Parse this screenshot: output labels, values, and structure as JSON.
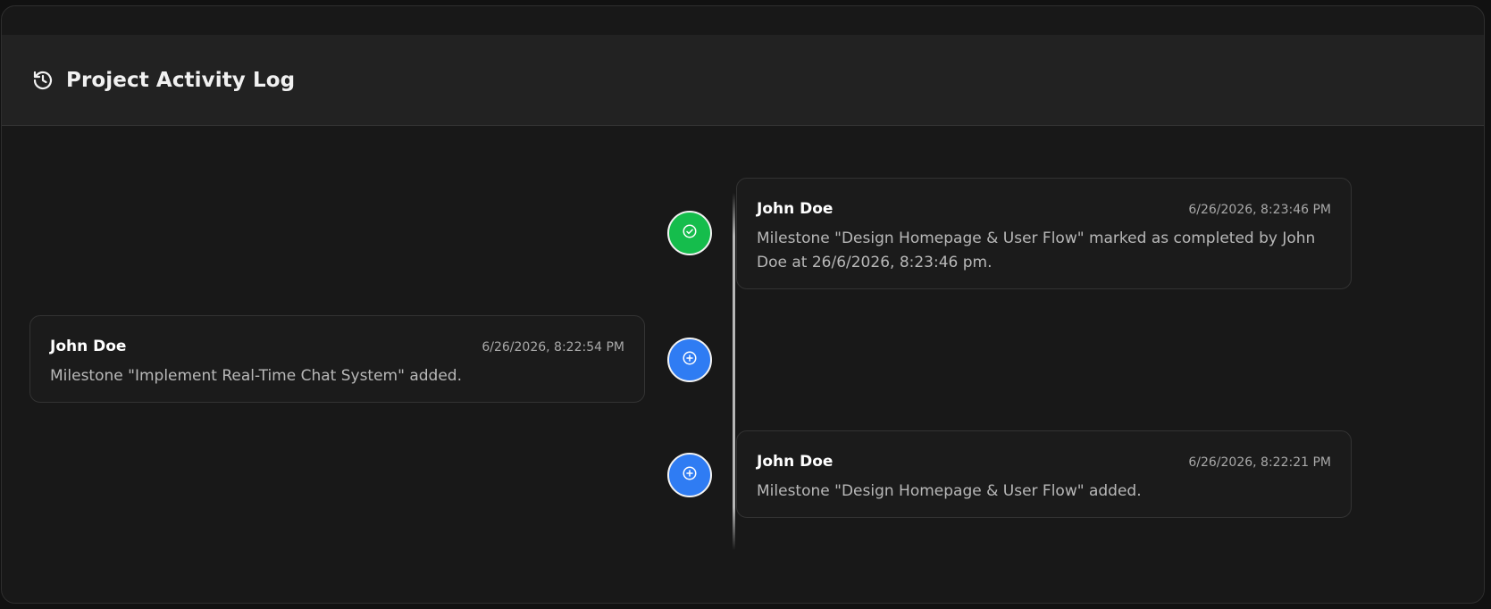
{
  "header": {
    "title": "Project Activity Log",
    "icon": "history-icon"
  },
  "colors": {
    "completed": "#15bd4c",
    "added": "#2f7cf3"
  },
  "activities": [
    {
      "author": "John Doe",
      "timestamp": "6/26/2026, 8:23:46 PM",
      "message": "Milestone \"Design Homepage & User Flow\" marked as completed by John Doe at 26/6/2026, 8:23:46 pm.",
      "type": "completed",
      "icon": "check-circle-icon",
      "side": "right"
    },
    {
      "author": "John Doe",
      "timestamp": "6/26/2026, 8:22:54 PM",
      "message": "Milestone \"Implement Real-Time Chat System\" added.",
      "type": "added",
      "icon": "plus-circle-icon",
      "side": "left"
    },
    {
      "author": "John Doe",
      "timestamp": "6/26/2026, 8:22:21 PM",
      "message": "Milestone \"Design Homepage & User Flow\" added.",
      "type": "added",
      "icon": "plus-circle-icon",
      "side": "right"
    }
  ]
}
